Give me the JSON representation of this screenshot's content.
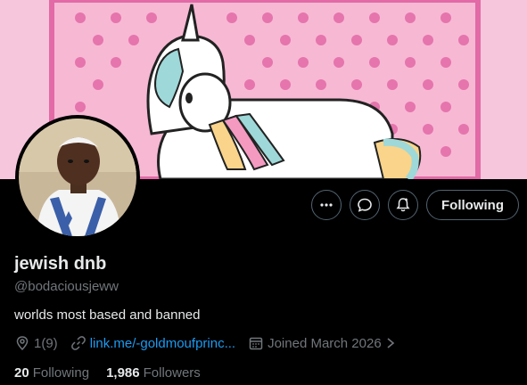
{
  "banner": {
    "description_icon": "unicorn-banner-image"
  },
  "avatar": {
    "icon": "profile-photo"
  },
  "actions": {
    "more_icon": "more-icon",
    "message_icon": "message-icon",
    "notify_icon": "notification-bell-icon",
    "follow_label": "Following"
  },
  "profile": {
    "name": "jewish dnb",
    "handle": "@bodaciousjeww",
    "bio": "worlds most based and banned",
    "location": "1(9)",
    "link": "link.me/-goldmoufprinc...",
    "joined": "Joined March 2026"
  },
  "stats": {
    "following_count": "20",
    "following_label": "Following",
    "followers_count": "1,986",
    "followers_label": "Followers"
  },
  "colors": {
    "accent": "#1d9bf0",
    "muted": "#71767b",
    "text": "#e7e9ea",
    "banner_pink": "#f6c6dc",
    "border_pink": "#e26aa6"
  }
}
